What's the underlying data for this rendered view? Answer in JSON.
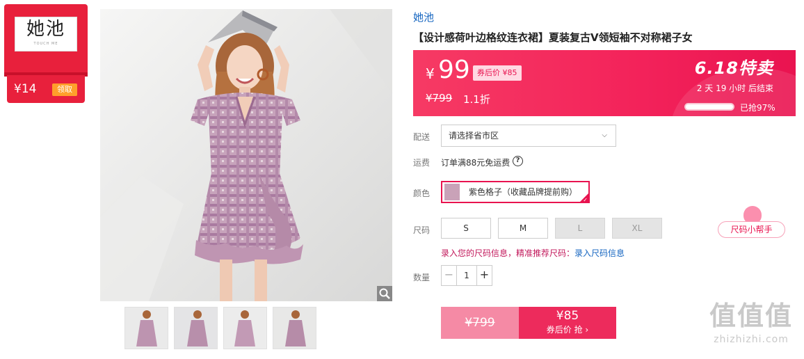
{
  "coupon": {
    "brand_logo_cn": "她池",
    "brand_logo_en": "TOUCH ME",
    "amount": "¥14",
    "claim_label": "领取"
  },
  "product": {
    "brand": "她池",
    "title": "【设计感荷叶边格纹连衣裙】夏装复古V领短袖不对称裙子女"
  },
  "price": {
    "currency": "¥",
    "current": "99",
    "after_coupon_tag": "券后价 ¥85",
    "original": "¥799",
    "discount": "1.1折",
    "promo_title": "6.18特卖",
    "countdown": "2 天 19 小时 后结束",
    "sold_percent": 97,
    "sold_label": "已抢97%"
  },
  "delivery": {
    "label": "配送",
    "placeholder": "请选择省市区"
  },
  "shipping": {
    "label": "运费",
    "text": "订单满88元免运费",
    "help": "?"
  },
  "color": {
    "label": "颜色",
    "selected": "紫色格子（收藏品牌提前购）"
  },
  "size": {
    "label": "尺码",
    "options": [
      {
        "name": "S",
        "available": true
      },
      {
        "name": "M",
        "available": true
      },
      {
        "name": "L",
        "available": false
      },
      {
        "name": "XL",
        "available": false
      }
    ],
    "hint_prefix": "录入您的尺码信息，精准推荐尺码：",
    "hint_link": "录入尺码信息",
    "helper": "尺码小帮手"
  },
  "quantity": {
    "label": "数量",
    "value": "1",
    "minus": "−",
    "plus": "+"
  },
  "buy": {
    "original": "¥799",
    "after_price": "¥85",
    "after_label": "券后价 抢 ›"
  },
  "watermark": {
    "big": "值值值",
    "url": "zhizhizhi.com"
  },
  "colors": {
    "accent": "#e8134f",
    "brand_link": "#1565c0",
    "coupon_red": "#e8203c"
  }
}
